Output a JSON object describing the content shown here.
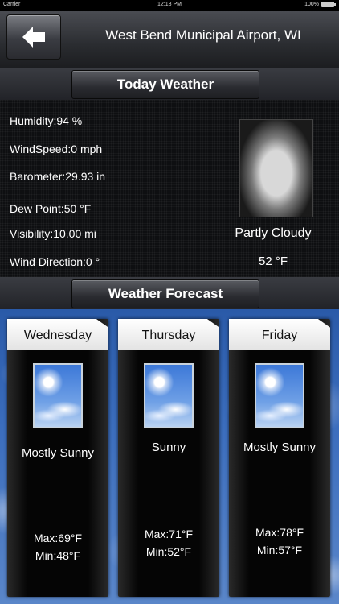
{
  "status_bar": {
    "carrier": "Carrier",
    "time": "12:18 PM",
    "battery": "100%"
  },
  "header": {
    "title": "West Bend Municipal Airport, WI"
  },
  "today": {
    "section_title": "Today Weather",
    "humidity": "Humidity:94 %",
    "wind_speed": "WindSpeed:0 mph",
    "barometer": "Barometer:29.93 in",
    "dew_point": "Dew Point:50 °F",
    "visibility": "Visibility:10.00 mi",
    "wind_direction": "Wind Direction:0 °",
    "condition": "Partly Cloudy",
    "temperature": "52 °F",
    "icon": "partly-cloudy-night-icon"
  },
  "forecast": {
    "section_title": "Weather Forecast",
    "days": [
      {
        "day": "Wednesday",
        "condition": "Mostly Sunny",
        "max": "Max:69°F",
        "min": "Min:48°F",
        "icon": "mostly-sunny-icon"
      },
      {
        "day": "Thursday",
        "condition": "Sunny",
        "max": "Max:71°F",
        "min": "Min:52°F",
        "icon": "sunny-icon"
      },
      {
        "day": "Friday",
        "condition": "Mostly Sunny",
        "max": "Max:78°F",
        "min": "Min:57°F",
        "icon": "mostly-sunny-icon"
      }
    ]
  }
}
